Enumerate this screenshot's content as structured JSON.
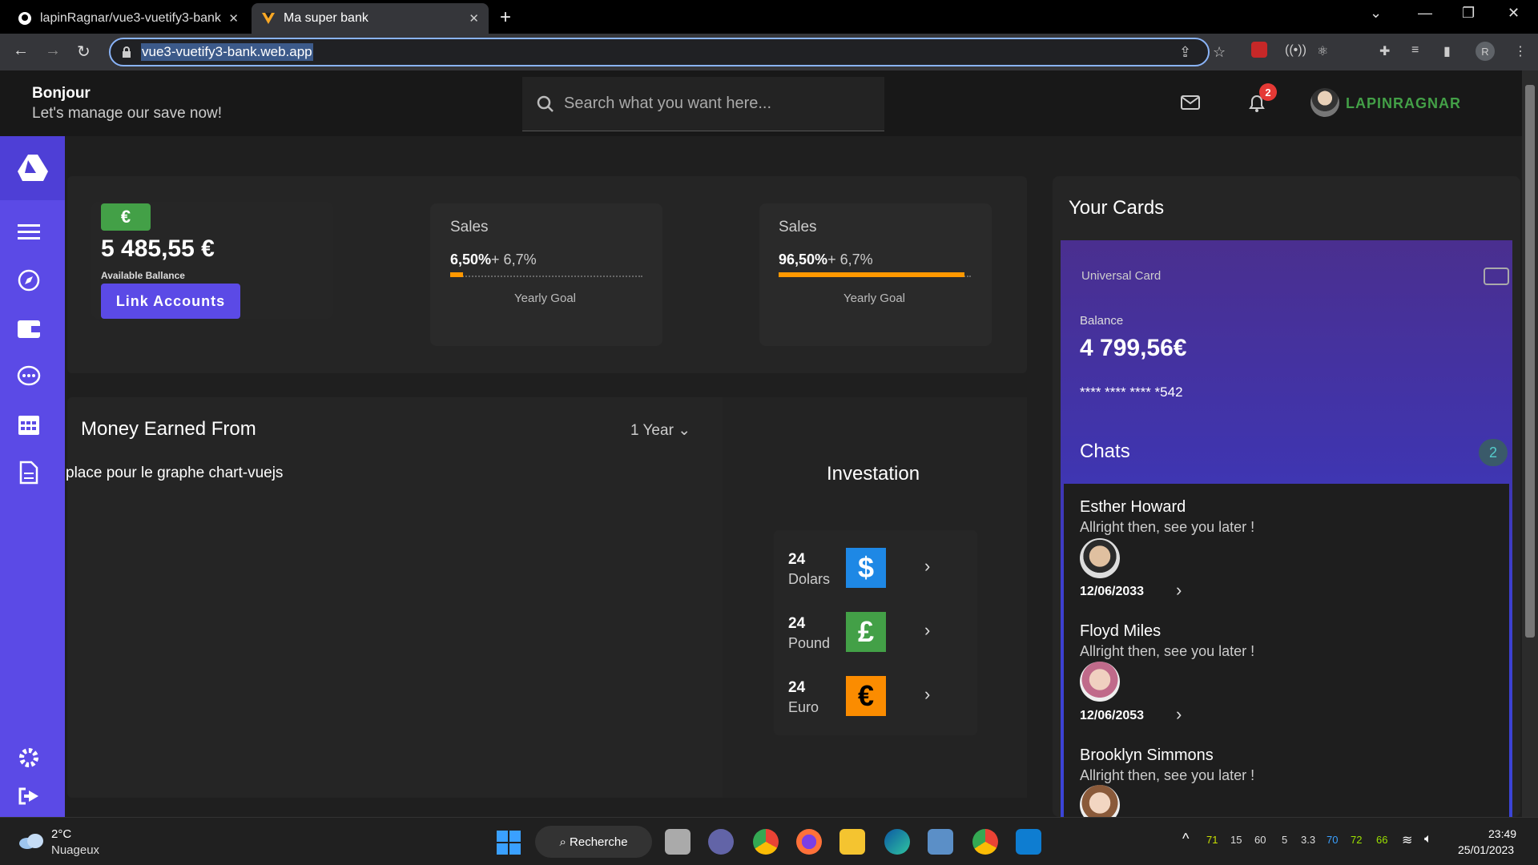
{
  "browser": {
    "tabs": [
      {
        "title": "lapinRagnar/vue3-vuetify3-bank"
      },
      {
        "title": "Ma super bank"
      }
    ],
    "url": "vue3-vuetify3-bank.web.app",
    "profile_initial": "R"
  },
  "header": {
    "greeting_title": "Bonjour",
    "greeting_subtitle": "Let's manage our save now!",
    "search_placeholder": "Search what you want here...",
    "notification_count": "2",
    "username": "LAPINRAGNAR"
  },
  "balance": {
    "currency_symbol": "€",
    "amount": "5 485,55 €",
    "label": "Available Ballance",
    "link_button": "Link Accounts"
  },
  "sales_cards": [
    {
      "title": "Sales",
      "percent": "6,50%",
      "delta": "+ 6,7%",
      "goal_label": "Yearly Goal",
      "progress": 0.065
    },
    {
      "title": "Sales",
      "percent": "96,50%",
      "delta": "+ 6,7%",
      "goal_label": "Yearly Goal",
      "progress": 0.965
    }
  ],
  "money_earned": {
    "title": "Money Earned From",
    "period": "1 Year",
    "placeholder": "place pour le graphe chart-vuejs"
  },
  "investation": {
    "title": "Investation",
    "items": [
      {
        "amount": "24",
        "unit": "Dolars",
        "symbol": "$",
        "color": "#1e88e5"
      },
      {
        "amount": "24",
        "unit": "Pound",
        "symbol": "£",
        "color": "#43a047"
      },
      {
        "amount": "24",
        "unit": "Euro",
        "symbol": "€",
        "color": "#fb8c00"
      }
    ]
  },
  "cards": {
    "title": "Your Cards",
    "card_name": "Universal Card",
    "balance_label": "Balance",
    "balance_value": "4 799,56€",
    "card_number": "**** **** **** *542"
  },
  "chats": {
    "title": "Chats",
    "count": "2",
    "items": [
      {
        "name": "Esther Howard",
        "message": "Allright then, see you later !",
        "date": "12/06/2033"
      },
      {
        "name": "Floyd Miles",
        "message": "Allright then, see you later !",
        "date": "12/06/2053"
      },
      {
        "name": "Brooklyn Simmons",
        "message": "Allright then, see you later !",
        "date": ""
      }
    ]
  },
  "taskbar": {
    "weather_temp": "2°C",
    "weather_desc": "Nuageux",
    "search_label": "Recherche",
    "tray_numbers": [
      "71",
      "15",
      "60",
      "5",
      "3.3",
      "70",
      "72",
      "66"
    ],
    "time": "23:49",
    "date": "25/01/2023"
  },
  "colors": {
    "accent": "#5b4ae6",
    "success": "#43a047",
    "warning": "#ff9800",
    "danger": "#e53935"
  }
}
